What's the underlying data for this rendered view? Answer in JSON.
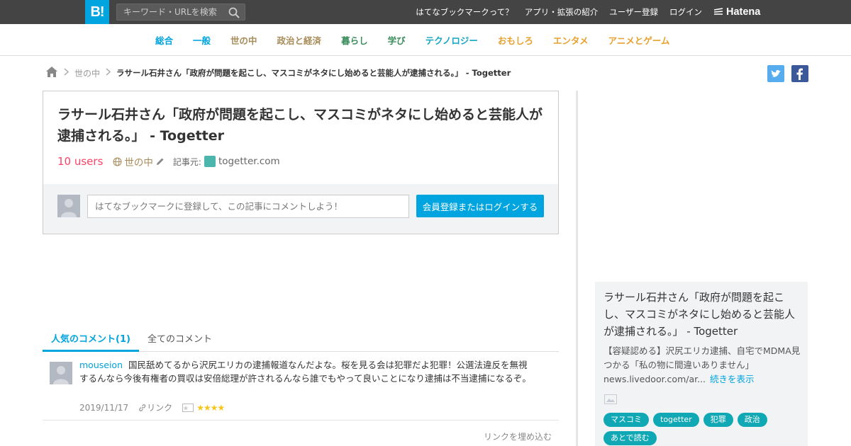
{
  "header": {
    "logo_text": "B!",
    "search_placeholder": "キーワード・URLを検索",
    "nav": [
      "はてなブックマークって？",
      "アプリ・拡張の紹介",
      "ユーザー登録",
      "ログイン"
    ],
    "hatena_label": "Hatena"
  },
  "categories": [
    {
      "label": "総合",
      "color": "#00a4de"
    },
    {
      "label": "一般",
      "color": "#00a4de"
    },
    {
      "label": "世の中",
      "color": "#a78b59"
    },
    {
      "label": "政治と経済",
      "color": "#a78b59"
    },
    {
      "label": "暮らし",
      "color": "#3b8d5c"
    },
    {
      "label": "学び",
      "color": "#3b8d5c"
    },
    {
      "label": "テクノロジー",
      "color": "#14a6c4"
    },
    {
      "label": "おもしろ",
      "color": "#e8a12e"
    },
    {
      "label": "エンタメ",
      "color": "#e8a12e"
    },
    {
      "label": "アニメとゲーム",
      "color": "#e8a12e"
    }
  ],
  "breadcrumb": {
    "category": "世の中",
    "current": "ラサール石井さん「政府が問題を起こし、マスコミがネタにし始めると芸能人が逮捕される。」 - Togetter"
  },
  "entry": {
    "title": "ラサール石井さん「政府が問題を起こし、マスコミがネタにし始めると芸能人が逮捕される。」 - Togetter",
    "users": "10 users",
    "category": "世の中",
    "source_label": "記事元:",
    "source": "togetter.com",
    "comment_placeholder": "はてなブックマークに登録して、この記事にコメントしよう！",
    "login_button": "会員登録またはログインする"
  },
  "tabs": [
    "人気のコメント(1)",
    "全てのコメント"
  ],
  "comment": {
    "user": "mouseion",
    "text": "国民舐めてるから沢尻エリカの逮捕報道なんだよな。桜を見る会は犯罪だよ犯罪！公選法違反を無視するんなら今後有権者の買収は安倍総理が許されるんなら誰でもやって良いことになり逮捕は不当逮捕になるぞ。",
    "date": "2019/11/17",
    "link_label": "リンク",
    "stars": "★★★★"
  },
  "embed_label": "リンクを埋め込む",
  "sidebar_card": {
    "title": "ラサール石井さん「政府が問題を起こし、マスコミがネタにし始めると芸能人が逮捕される。」 - Togetter",
    "summary": "【容疑認める】沢尻エリカ逮捕、自宅でMDMA見つかる「私の物に間違いありません」 news.livedoor.com/ar...",
    "more": "続きを表示",
    "tags": [
      "マスコミ",
      "togetter",
      "犯罪",
      "政治",
      "あとで読む"
    ]
  }
}
